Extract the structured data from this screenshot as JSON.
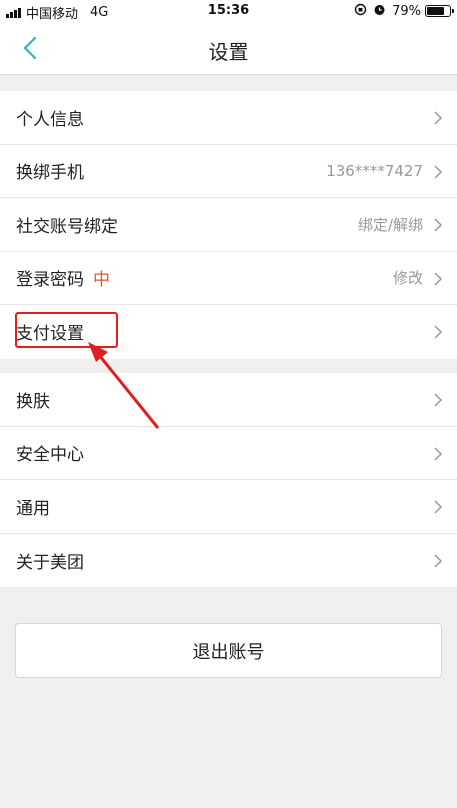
{
  "status_bar": {
    "carrier": "中国移动",
    "network": "4G",
    "time": "15:36",
    "battery": "79%",
    "battery_level": 0.79
  },
  "nav": {
    "title": "设置",
    "back_icon": "chevron-left-icon",
    "accent_color": "#2fb8a7"
  },
  "group1": [
    {
      "label": "个人信息",
      "value": ""
    },
    {
      "label": "换绑手机",
      "value": "136****7427"
    },
    {
      "label": "社交账号绑定",
      "value": "绑定/解绑"
    },
    {
      "label": "登录密码",
      "tag": "中",
      "value": "修改"
    },
    {
      "label": "支付设置",
      "value": ""
    }
  ],
  "group2": [
    {
      "label": "换肤"
    },
    {
      "label": "安全中心"
    },
    {
      "label": "通用"
    },
    {
      "label": "关于美团"
    }
  ],
  "logout": {
    "label": "退出账号"
  },
  "colors": {
    "annotation": "#e02020",
    "tag": "#e4572e"
  }
}
